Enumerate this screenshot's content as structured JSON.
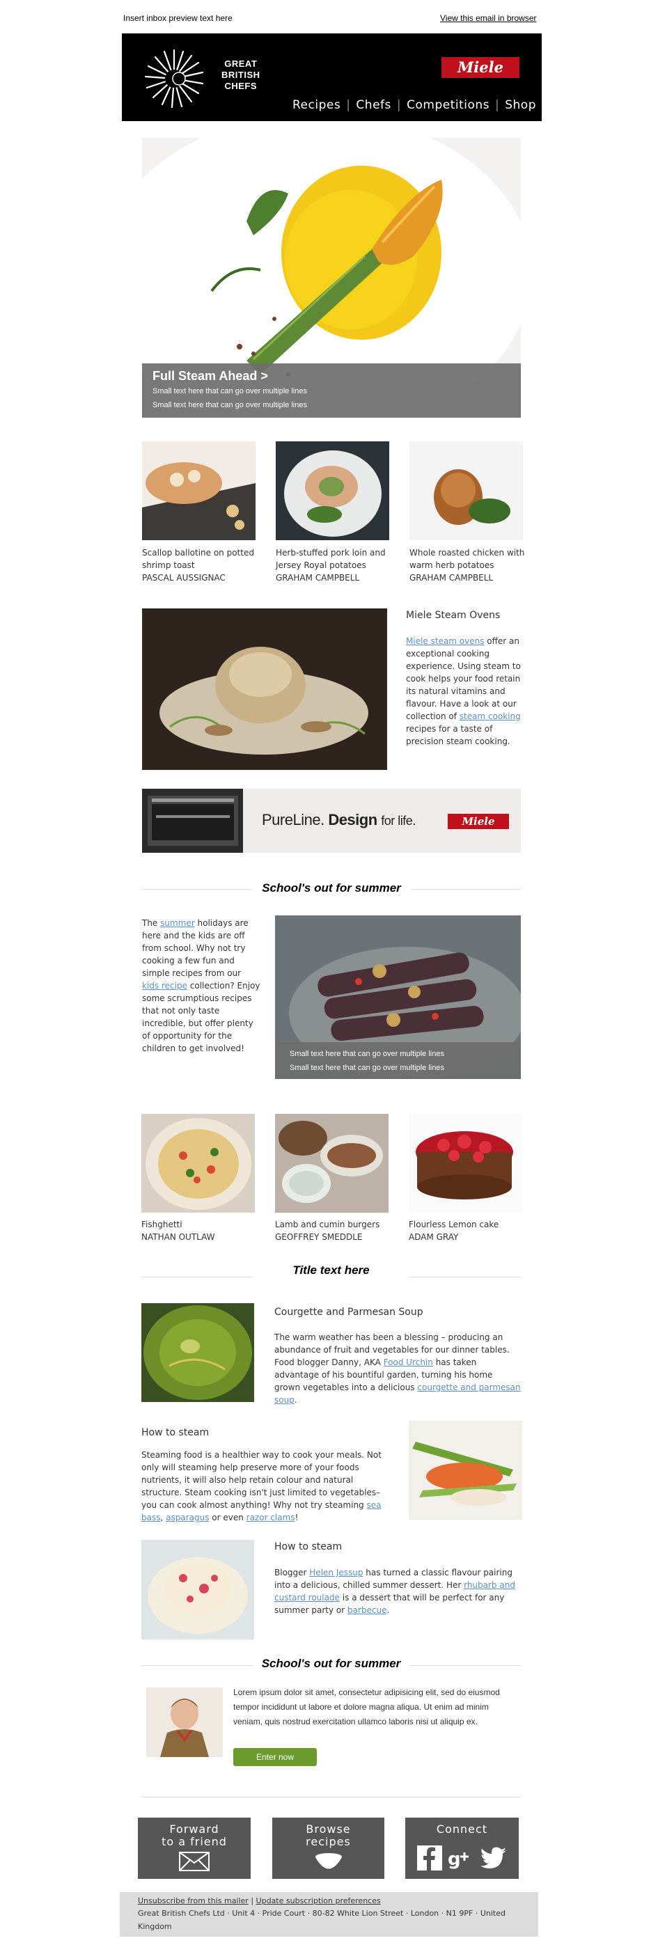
{
  "preheader": {
    "text": "Insert inbox preview text here",
    "view_in_browser": "View this email in browser"
  },
  "header": {
    "brand_lines": [
      "GREAT",
      "BRITISH",
      "CHEFS"
    ],
    "partner_logo": "Miele",
    "nav": [
      "Recipes",
      "Chefs",
      "Competitions",
      "Shop"
    ]
  },
  "hero": {
    "title": "Full Steam Ahead >",
    "lines": [
      "Small text here that can go over multiple lines",
      "Small text here that can go over multiple lines"
    ]
  },
  "recipes_row1": [
    {
      "name_lines": [
        "Scallop ballotine on potted",
        "shrimp toast"
      ],
      "chef": "PASCAL AUSSIGNAC"
    },
    {
      "name_lines": [
        "Herb-stuffed pork loin and",
        "Jersey Royal potatoes"
      ],
      "chef": "GRAHAM CAMPBELL"
    },
    {
      "name_lines": [
        "Whole roasted chicken with",
        "warm herb potatoes"
      ],
      "chef": "GRAHAM CAMPBELL"
    }
  ],
  "miele_feature": {
    "title": "Miele Steam Ovens",
    "link1": "Miele steam ovens",
    "text1": " offer an exceptional cooking experience. Using steam to cook helps your food retain its natural vitamins and flavour. Have a look at our collection of ",
    "link2": "steam cooking",
    "text2": " recipes for a taste of precision steam cooking."
  },
  "banner": {
    "pureline": "PureLine.",
    "design": "Design",
    "for_life": "for life.",
    "logo": "Miele"
  },
  "school_section": {
    "heading": "School's out for summer",
    "text_pre": "The ",
    "link1": "summer",
    "text_mid": " holidays are here and the kids are off from school. Why not try cooking a few fun and simple recipes from our ",
    "link2": "kids recipe",
    "text_post": " collection? Enjoy some scrumptious recipes that not only taste incredible, but offer plenty of opportunity for the children to get involved!",
    "caption_lines": [
      "Small text here that can go over multiple lines",
      "Small text here that can go over multiple lines"
    ]
  },
  "recipes_row2": [
    {
      "name": "Fishghetti",
      "chef": "NATHAN OUTLAW"
    },
    {
      "name": "Lamb and cumin burgers",
      "chef": "GEOFFREY SMEDDLE"
    },
    {
      "name": "Flourless Lemon cake",
      "chef": "ADAM GRAY"
    }
  ],
  "title_section": {
    "heading": "Title text here"
  },
  "article1": {
    "title": "Courgette and Parmesan Soup",
    "text_pre": "The warm weather has been a blessing – producing an abundance of fruit and vegetables for our dinner tables. Food blogger Danny, AKA ",
    "link1": "Food Urchin",
    "text_mid": " has taken advantage of his bountiful garden, turning his home grown vegetables into a delicious ",
    "link2": "courgette and parmesan soup",
    "text_post": "."
  },
  "article2": {
    "title": "How to steam",
    "text_pre": "Steaming food is a healthier way to cook your meals. Not only will steaming help preserve more of your foods nutrients, it will also help retain colour and natural structure. Steam cooking isn't just limited to vegetables– you can cook almost anything! Why not try steaming ",
    "link1": "sea bass",
    "sep": ", ",
    "link2": "asparagus",
    "text_mid": " or even ",
    "link3": "razor clams",
    "text_post": "!"
  },
  "article3": {
    "title": "How to steam",
    "text_pre": "Blogger ",
    "link1": "Helen Jessup",
    "text_mid": " has turned a classic flavour pairing into a delicious, chilled summer dessert. Her ",
    "link2": "rhubarb and custard roulade",
    "text_mid2": " is a dessert that will be perfect for any summer party or ",
    "link3": "barbecue",
    "text_post": "."
  },
  "competition": {
    "heading": "School's out for summer",
    "text": "Lorem ipsum dolor sit amet, consectetur adipisicing elit, sed do eiusmod tempor incididunt ut labore et dolore magna aliqua. Ut enim ad minim veniam, quis nostrud exercitation ullamco laboris nisi ut aliquip ex.",
    "button": "Enter now"
  },
  "footer_boxes": {
    "forward_lines": [
      "Forward",
      "to a friend"
    ],
    "browse_lines": [
      "Browse",
      "recipes"
    ],
    "connect": "Connect"
  },
  "footer": {
    "unsubscribe": "Unsubscribe from this mailer",
    "separator": " | ",
    "update": "Update subscription preferences",
    "address": "Great British Chefs Ltd · Unit 4 · Pride Court · 80-82 White Lion Street · London · N1 9PF · United Kingdom"
  },
  "icons": [
    "envelope-icon",
    "bowl-icon",
    "facebook-icon",
    "google-plus-icon",
    "twitter-icon"
  ],
  "colors": {
    "header_bg": "#000000",
    "miele_red": "#c0101b",
    "link": "#5b8fc7",
    "button_green": "#6c9b2d",
    "footer_box": "#565656"
  }
}
